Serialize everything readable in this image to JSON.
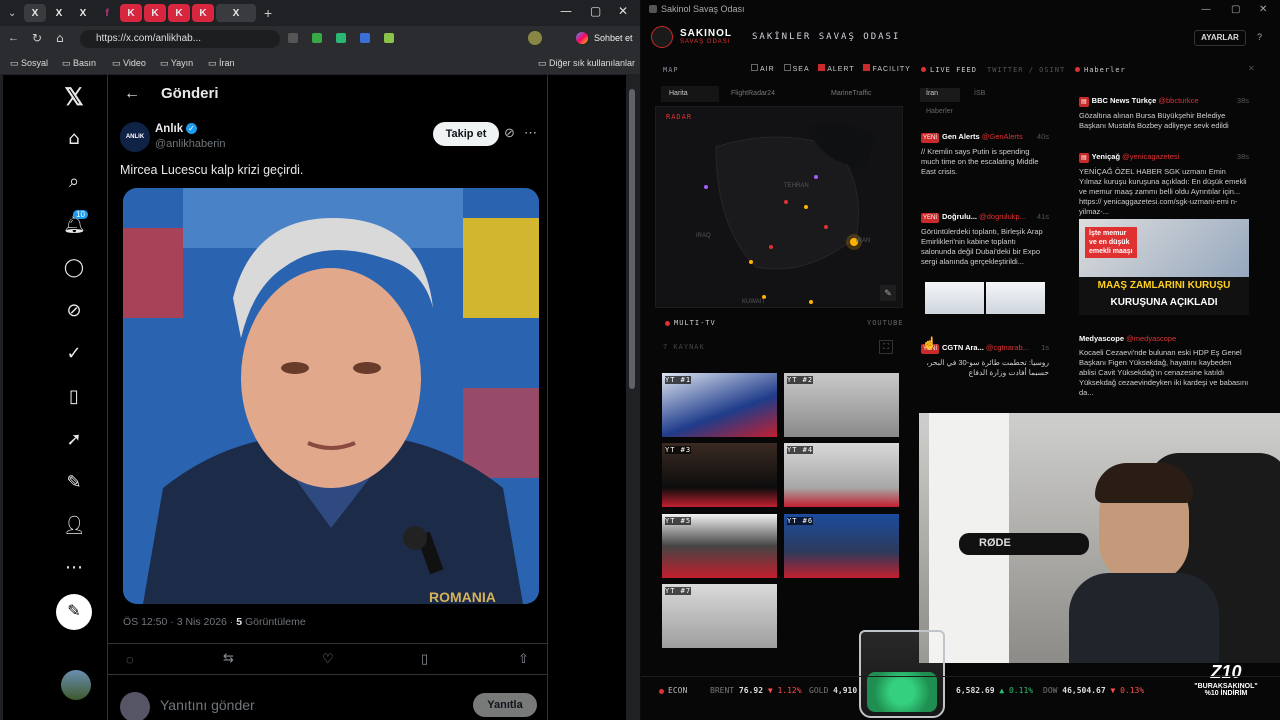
{
  "browser": {
    "tab_letters": [
      "X",
      "X",
      "X",
      "f",
      "K",
      "K",
      "K",
      "K",
      "X"
    ],
    "url": "https://x.com/anlikhab...",
    "chat_label": "Sohbet et",
    "bookmarks": [
      "Sosyal",
      "Basın",
      "Video",
      "Yayın",
      "İran"
    ],
    "bookmarks_other": "Diğer sık kullanılanlar"
  },
  "x": {
    "header_title": "Gönderi",
    "author_name": "Anlık",
    "author_handle": "@anlikhaberin",
    "avatar_text": "ANLIK",
    "follow_label": "Takip et",
    "tweet_text": "Mircea Lucescu kalp krizi geçirdi.",
    "notif_count": "10",
    "meta_time": "ÖS 12:50 · 3 Nis 2026 · ",
    "meta_views": "5",
    "meta_views_label": " Görüntüleme",
    "reply_placeholder": "Yanıtını gönder",
    "reply_button": "Yanıtla",
    "shirt_text": "ROMANIA"
  },
  "war_room": {
    "window_title": "Sakinol Savaş Odası",
    "logo_main": "SAKINOL",
    "logo_sub": "SAVAŞ ODASI",
    "header_title": "SAKİNLER SAVAŞ ODASI",
    "settings_button": "AYARLAR",
    "map_label": "MAP",
    "filters": [
      "AIR",
      "SEA",
      "ALERT",
      "FACILITY"
    ],
    "map_tabs": [
      "Harita",
      "FlightRadar24",
      "MarineTraffic"
    ],
    "radar_label": "RADAR",
    "map_places": [
      "TEHRAN",
      "IRAQ",
      "IRAN",
      "KUWAIT"
    ],
    "live_feed_label": "LIVE FEED",
    "live_feed_sub": "TWITTER / OSINT",
    "feed_tabs": [
      "İran",
      "İSB"
    ],
    "feed_sub_tab": "Haberler",
    "feed": [
      {
        "tag": "YENİ",
        "source": "Gen Alerts",
        "handle": "@GenAlerts",
        "time": "40s",
        "text": "// Kremlin says Putin is spending much time on the escalating Middle East crisis."
      },
      {
        "tag": "YENİ",
        "source": "Doğrulu...",
        "handle": "@dogrulukp...",
        "time": "41s",
        "text": "Görüntülerdeki toplantı, Birleşik Arap Emirlikleri'nin kabine toplantı salonunda değil Dubai'deki bir Expo sergi alanında gerçekleştirildi..."
      },
      {
        "tag": "YENİ",
        "source": "CGTN Ara...",
        "handle": "@cgtnarab...",
        "time": "1s",
        "text": "روسيا: تحطمت طائرة سو-30 في البحر، حسبما أفادت وزارة الدفاع"
      }
    ],
    "news_label": "Haberler",
    "news": [
      {
        "source": "BBC News Türkçe",
        "handle": "@bbcturkce",
        "time": "38s",
        "text": "Gözaltına alınan Bursa Büyükşehir Belediye Başkanı Mustafa Bozbey adliyeye sevk edildi"
      },
      {
        "source": "Yeniçağ",
        "handle": "@yenicagazetesi",
        "time": "38s",
        "text": "YENİÇAĞ ÖZEL HABER SGK uzmanı Emin Yılmaz kuruşu kuruşuna açıkladı: En düşük emekli ve memur maaş zammı belli oldu Ayrıntılar için... https:// yenicaggazetesi.com/sgk-uzmani-emi n-yilmaz-..."
      },
      {
        "source": "Medyascope",
        "handle": "@medyascope",
        "time": "",
        "text": "Kocaeli Cezaevi'nde bulunan eski HDP Eş Genel Başkanı Figen Yüksekdağ, hayatını kaybeden ablisi Cavit Yüksekdağ'ın cenazesine katıldı Yüksekdağ cezaevindeyken iki kardeşi ve babasını da..."
      }
    ],
    "news_image_lines": [
      "İşte memur",
      "ve en düşük",
      "emekli maaşı",
      "MAAŞ ZAMLARINI KURUŞU",
      "KURUŞUNA AÇIKLADI"
    ],
    "multitv_label": "MULTI-TV",
    "multitv_sub": "YOUTUBE",
    "multitv_count": "7 KAYNAK",
    "tv_labels": [
      "YT #1",
      "YT #2",
      "YT #3",
      "YT #4",
      "YT #5",
      "YT #6",
      "YT #7"
    ],
    "ticker": [
      {
        "label": "ECON"
      },
      {
        "label": "BRENT",
        "value": "76.92",
        "change": "▼ 1.12%",
        "dir": "down"
      },
      {
        "label": "GOLD",
        "value": "4,910",
        "change": "",
        "dir": ""
      },
      {
        "label": "",
        "value": "6,582.69",
        "change": "▲ 0.11%",
        "dir": "up"
      },
      {
        "label": "DOW",
        "value": "46,504.67",
        "change": "▼ 0.13%",
        "dir": "down"
      }
    ],
    "promo_brand": "Z10",
    "promo_code": "\"BURAKSAKINOL\"",
    "promo_text": "%10 İNDİRİM",
    "mic_brand": "RØDE"
  },
  "colors": {
    "accent_red": "#e03131",
    "x_blue": "#1d9bf0",
    "up_green": "#2fbf71",
    "down_red": "#ff4d4d"
  }
}
